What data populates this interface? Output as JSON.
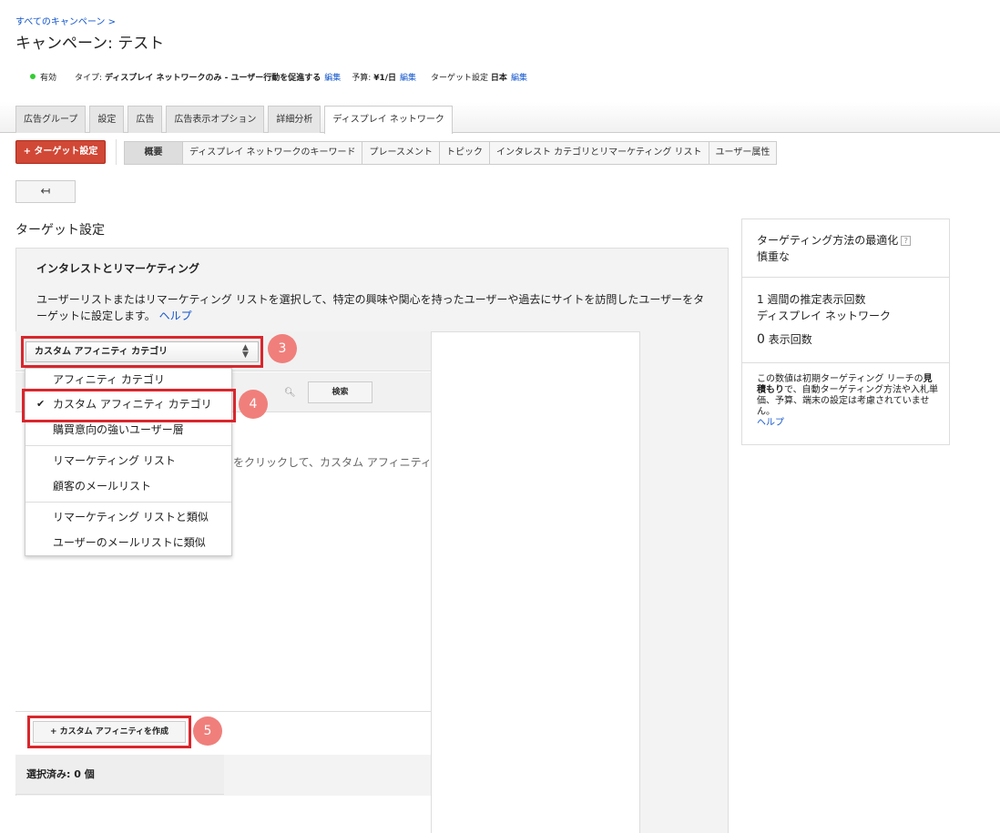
{
  "breadcrumb": "すべてのキャンペーン >",
  "page_title": "キャンペーン: テスト",
  "status": {
    "state": "有効",
    "type_label": "タイプ:",
    "type_value": "ディスプレイ ネットワークのみ - ユーザー行動を促進する",
    "budget_label": "予算:",
    "budget_value": "¥1/日",
    "target_label": "ターゲット設定",
    "target_value": "日本",
    "edit": "編集"
  },
  "tabs": [
    "広告グループ",
    "設定",
    "広告",
    "広告表示オプション",
    "詳細分析",
    "ディスプレイ ネットワーク"
  ],
  "target_button": "+ ターゲット設定",
  "subtabs": [
    "概要",
    "ディスプレイ ネットワークのキーワード",
    "プレースメント",
    "トピック",
    "インタレスト カテゴリとリマーケティング リスト",
    "ユーザー属性"
  ],
  "back_icon": "↤",
  "section_title": "ターゲット設定",
  "panel": {
    "heading": "インタレストとリマーケティング",
    "description": "ユーザーリストまたはリマーケティング リストを選択して、特定の興味や関心を持ったユーザーや過去にサイトを訪問したユーザーをターゲットに設定します。",
    "help": "ヘルプ"
  },
  "select_value": "カスタム アフィニティ カテゴリ",
  "search_button": "検索",
  "hint_text": "をクリックして、カスタム アフィニティ",
  "dropdown": {
    "items": [
      "アフィニティ カテゴリ",
      "カスタム アフィニティ カテゴリ",
      "購買意向の強いユーザー層",
      "リマーケティング リスト",
      "顧客のメールリスト",
      "リマーケティング リストと類似",
      "ユーザーのメールリストに類似"
    ],
    "checked_index": 1
  },
  "badges": [
    "3",
    "4",
    "5"
  ],
  "create_button": "+ カスタム アフィニティを作成",
  "selected_count": "選択済み: 0 個",
  "side": {
    "opt_title": "ターゲティング方法の最適化",
    "opt_value": "慎重な",
    "weekly_title": "1 週間の推定表示回数",
    "weekly_network": "ディスプレイ ネットワーク",
    "impressions_value": "0",
    "impressions_label": "表示回数",
    "note_1": "この数値は初期ターゲティング リーチの",
    "note_bold": "見積もり",
    "note_2": "で、自動ターゲティング方法や入札単価、予算、端末の設定は考慮されていません。",
    "help": "ヘルプ",
    "help_q": "?"
  }
}
